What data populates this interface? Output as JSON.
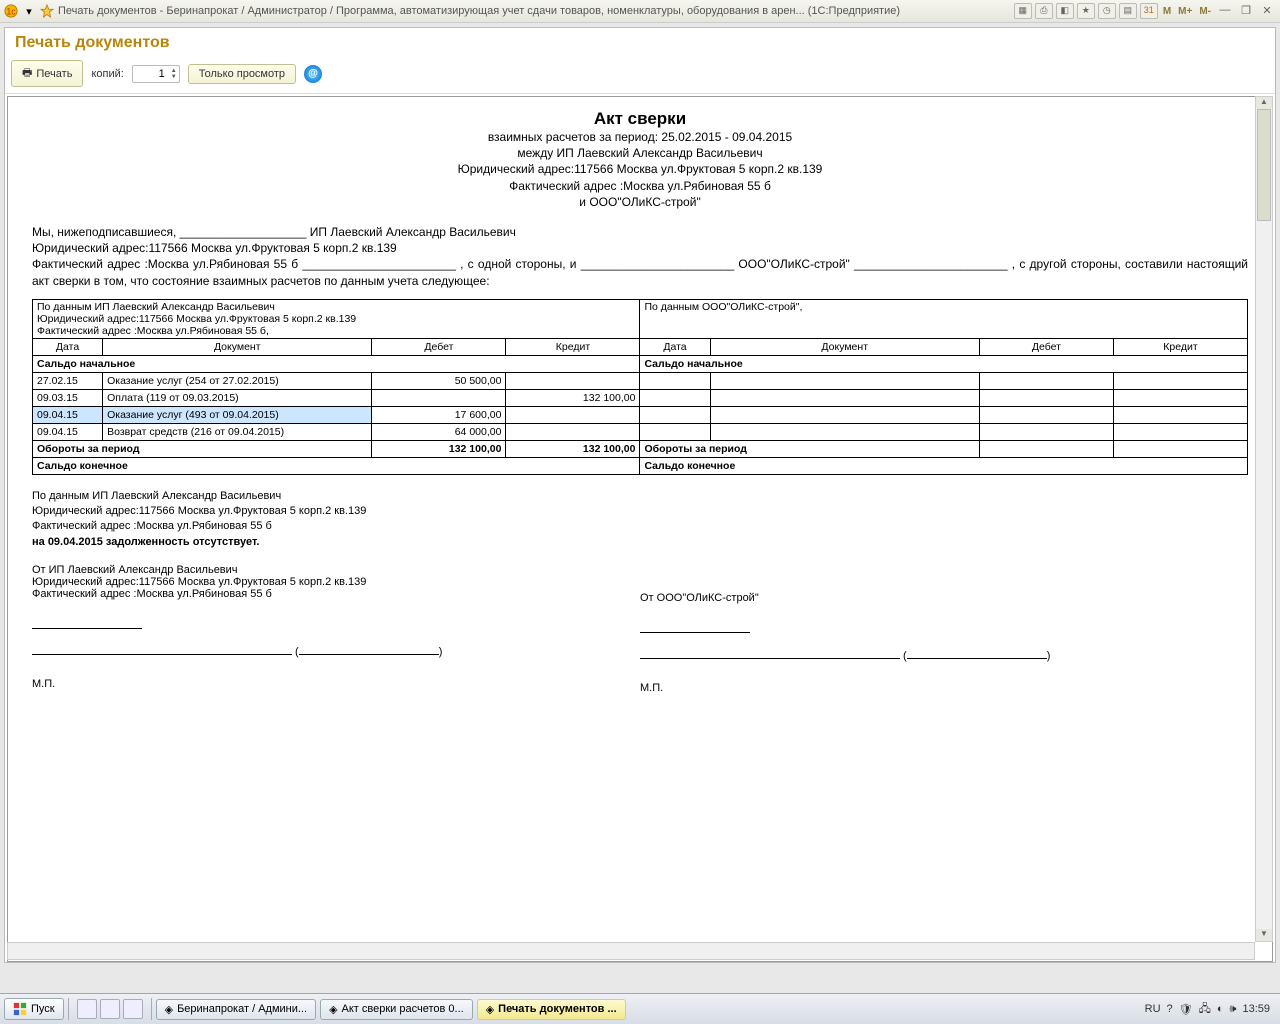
{
  "titlebar": {
    "title": "Печать документов - Беринапрокат / Администратор / Программа, автоматизирующая учет сдачи товаров, номенклатуры, оборудования в арен...  (1С:Предприятие)",
    "m1": "M",
    "m2": "M+",
    "m3": "M-"
  },
  "header": {
    "title": "Печать документов"
  },
  "toolbar": {
    "print": "Печать",
    "copies_label": "копий:",
    "copies": "1",
    "view_only": "Только просмотр"
  },
  "doc": {
    "title": "Акт сверки",
    "line1": "взаимных расчетов за период: 25.02.2015 - 09.04.2015",
    "line2": "между ИП Лаевский Александр Васильевич",
    "line3": "Юридический адрес:117566 Москва ул.Фруктовая 5 корп.2 кв.139",
    "line4": "Фактический адрес :Москва ул.Рябиновая 55 б",
    "line5": "и ООО\"ОЛиКС-строй\"",
    "para1_a": "Мы, нижеподписавшиеся, ___________________ ИП Лаевский Александр Васильевич",
    "para1_b": "Юридический адрес:117566 Москва ул.Фруктовая 5 корп.2 кв.139",
    "para1_c": "Фактический  адрес :Москва  ул.Рябиновая  55  б  _______________________ ,  с  одной  стороны,  и  _______________________  ООО\"ОЛиКС-строй\" _______________________ , с другой стороны, составили настоящий акт сверки в том, что состояние взаимных расчетов по данным учета следующее:",
    "left_header": "По данным ИП Лаевский Александр Васильевич",
    "left_header2": "Юридический адрес:117566 Москва ул.Фруктовая 5 корп.2 кв.139",
    "left_header3": "Фактический адрес :Москва ул.Рябиновая 55 б,",
    "right_header": "По данным ООО\"ОЛиКС-строй\",",
    "col_date": "Дата",
    "col_doc": "Документ",
    "col_debit": "Дебет",
    "col_credit": "Кредит",
    "row_start": "Сальдо начальное",
    "rows": [
      {
        "date": "27.02.15",
        "doc": "Оказание услуг (254 от 27.02.2015)",
        "debit": "50 500,00",
        "credit": ""
      },
      {
        "date": "09.03.15",
        "doc": "Оплата (119 от 09.03.2015)",
        "debit": "",
        "credit": "132 100,00"
      },
      {
        "date": "09.04.15",
        "doc": "Оказание услуг (493 от 09.04.2015)",
        "debit": "17 600,00",
        "credit": ""
      },
      {
        "date": "09.04.15",
        "doc": "Возврат средств (216 от 09.04.2015)",
        "debit": "64 000,00",
        "credit": ""
      }
    ],
    "row_turn": "Обороты за период",
    "turn_debit": "132 100,00",
    "turn_credit": "132 100,00",
    "row_end": "Сальдо конечное",
    "foot1": "По данным ИП Лаевский Александр Васильевич",
    "foot2": "Юридический адрес:117566 Москва ул.Фруктовая 5 корп.2 кв.139",
    "foot3": "Фактический адрес :Москва ул.Рябиновая 55 б",
    "foot4": "на 09.04.2015 задолженность отсутствует.",
    "from_left": "От ИП Лаевский Александр Васильевич",
    "from_left2": "Юридический адрес:117566 Москва ул.Фруктовая 5 корп.2 кв.139",
    "from_left3": "Фактический адрес :Москва ул.Рябиновая 55 б",
    "from_right": "От ООО\"ОЛиКС-строй\"",
    "mp": "М.П."
  },
  "taskbar": {
    "start": "Пуск",
    "tasks": [
      {
        "label": "Беринапрокат / Админи..."
      },
      {
        "label": "Акт сверки расчетов 0..."
      },
      {
        "label": "Печать документов ...",
        "active": true
      }
    ],
    "lang": "RU",
    "time": "13:59"
  }
}
